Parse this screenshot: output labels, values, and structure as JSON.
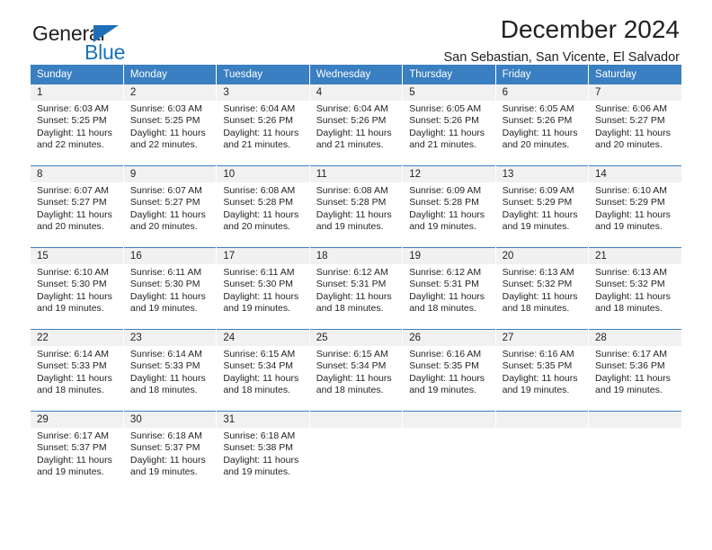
{
  "brand": {
    "name_part1": "General",
    "name_part2": "Blue",
    "accent_color": "#1872bb"
  },
  "header": {
    "title": "December 2024",
    "subtitle": "San Sebastian, San Vicente, El Salvador"
  },
  "calendar": {
    "header_bg": "#3a7fc1",
    "daynum_bg": "#f1f1f1",
    "weekday_headers": [
      "Sunday",
      "Monday",
      "Tuesday",
      "Wednesday",
      "Thursday",
      "Friday",
      "Saturday"
    ],
    "weeks": [
      [
        {
          "day": "1",
          "sunrise": "Sunrise: 6:03 AM",
          "sunset": "Sunset: 5:25 PM",
          "daylight1": "Daylight: 11 hours",
          "daylight2": "and 22 minutes."
        },
        {
          "day": "2",
          "sunrise": "Sunrise: 6:03 AM",
          "sunset": "Sunset: 5:25 PM",
          "daylight1": "Daylight: 11 hours",
          "daylight2": "and 22 minutes."
        },
        {
          "day": "3",
          "sunrise": "Sunrise: 6:04 AM",
          "sunset": "Sunset: 5:26 PM",
          "daylight1": "Daylight: 11 hours",
          "daylight2": "and 21 minutes."
        },
        {
          "day": "4",
          "sunrise": "Sunrise: 6:04 AM",
          "sunset": "Sunset: 5:26 PM",
          "daylight1": "Daylight: 11 hours",
          "daylight2": "and 21 minutes."
        },
        {
          "day": "5",
          "sunrise": "Sunrise: 6:05 AM",
          "sunset": "Sunset: 5:26 PM",
          "daylight1": "Daylight: 11 hours",
          "daylight2": "and 21 minutes."
        },
        {
          "day": "6",
          "sunrise": "Sunrise: 6:05 AM",
          "sunset": "Sunset: 5:26 PM",
          "daylight1": "Daylight: 11 hours",
          "daylight2": "and 20 minutes."
        },
        {
          "day": "7",
          "sunrise": "Sunrise: 6:06 AM",
          "sunset": "Sunset: 5:27 PM",
          "daylight1": "Daylight: 11 hours",
          "daylight2": "and 20 minutes."
        }
      ],
      [
        {
          "day": "8",
          "sunrise": "Sunrise: 6:07 AM",
          "sunset": "Sunset: 5:27 PM",
          "daylight1": "Daylight: 11 hours",
          "daylight2": "and 20 minutes."
        },
        {
          "day": "9",
          "sunrise": "Sunrise: 6:07 AM",
          "sunset": "Sunset: 5:27 PM",
          "daylight1": "Daylight: 11 hours",
          "daylight2": "and 20 minutes."
        },
        {
          "day": "10",
          "sunrise": "Sunrise: 6:08 AM",
          "sunset": "Sunset: 5:28 PM",
          "daylight1": "Daylight: 11 hours",
          "daylight2": "and 20 minutes."
        },
        {
          "day": "11",
          "sunrise": "Sunrise: 6:08 AM",
          "sunset": "Sunset: 5:28 PM",
          "daylight1": "Daylight: 11 hours",
          "daylight2": "and 19 minutes."
        },
        {
          "day": "12",
          "sunrise": "Sunrise: 6:09 AM",
          "sunset": "Sunset: 5:28 PM",
          "daylight1": "Daylight: 11 hours",
          "daylight2": "and 19 minutes."
        },
        {
          "day": "13",
          "sunrise": "Sunrise: 6:09 AM",
          "sunset": "Sunset: 5:29 PM",
          "daylight1": "Daylight: 11 hours",
          "daylight2": "and 19 minutes."
        },
        {
          "day": "14",
          "sunrise": "Sunrise: 6:10 AM",
          "sunset": "Sunset: 5:29 PM",
          "daylight1": "Daylight: 11 hours",
          "daylight2": "and 19 minutes."
        }
      ],
      [
        {
          "day": "15",
          "sunrise": "Sunrise: 6:10 AM",
          "sunset": "Sunset: 5:30 PM",
          "daylight1": "Daylight: 11 hours",
          "daylight2": "and 19 minutes."
        },
        {
          "day": "16",
          "sunrise": "Sunrise: 6:11 AM",
          "sunset": "Sunset: 5:30 PM",
          "daylight1": "Daylight: 11 hours",
          "daylight2": "and 19 minutes."
        },
        {
          "day": "17",
          "sunrise": "Sunrise: 6:11 AM",
          "sunset": "Sunset: 5:30 PM",
          "daylight1": "Daylight: 11 hours",
          "daylight2": "and 19 minutes."
        },
        {
          "day": "18",
          "sunrise": "Sunrise: 6:12 AM",
          "sunset": "Sunset: 5:31 PM",
          "daylight1": "Daylight: 11 hours",
          "daylight2": "and 18 minutes."
        },
        {
          "day": "19",
          "sunrise": "Sunrise: 6:12 AM",
          "sunset": "Sunset: 5:31 PM",
          "daylight1": "Daylight: 11 hours",
          "daylight2": "and 18 minutes."
        },
        {
          "day": "20",
          "sunrise": "Sunrise: 6:13 AM",
          "sunset": "Sunset: 5:32 PM",
          "daylight1": "Daylight: 11 hours",
          "daylight2": "and 18 minutes."
        },
        {
          "day": "21",
          "sunrise": "Sunrise: 6:13 AM",
          "sunset": "Sunset: 5:32 PM",
          "daylight1": "Daylight: 11 hours",
          "daylight2": "and 18 minutes."
        }
      ],
      [
        {
          "day": "22",
          "sunrise": "Sunrise: 6:14 AM",
          "sunset": "Sunset: 5:33 PM",
          "daylight1": "Daylight: 11 hours",
          "daylight2": "and 18 minutes."
        },
        {
          "day": "23",
          "sunrise": "Sunrise: 6:14 AM",
          "sunset": "Sunset: 5:33 PM",
          "daylight1": "Daylight: 11 hours",
          "daylight2": "and 18 minutes."
        },
        {
          "day": "24",
          "sunrise": "Sunrise: 6:15 AM",
          "sunset": "Sunset: 5:34 PM",
          "daylight1": "Daylight: 11 hours",
          "daylight2": "and 18 minutes."
        },
        {
          "day": "25",
          "sunrise": "Sunrise: 6:15 AM",
          "sunset": "Sunset: 5:34 PM",
          "daylight1": "Daylight: 11 hours",
          "daylight2": "and 18 minutes."
        },
        {
          "day": "26",
          "sunrise": "Sunrise: 6:16 AM",
          "sunset": "Sunset: 5:35 PM",
          "daylight1": "Daylight: 11 hours",
          "daylight2": "and 19 minutes."
        },
        {
          "day": "27",
          "sunrise": "Sunrise: 6:16 AM",
          "sunset": "Sunset: 5:35 PM",
          "daylight1": "Daylight: 11 hours",
          "daylight2": "and 19 minutes."
        },
        {
          "day": "28",
          "sunrise": "Sunrise: 6:17 AM",
          "sunset": "Sunset: 5:36 PM",
          "daylight1": "Daylight: 11 hours",
          "daylight2": "and 19 minutes."
        }
      ],
      [
        {
          "day": "29",
          "sunrise": "Sunrise: 6:17 AM",
          "sunset": "Sunset: 5:37 PM",
          "daylight1": "Daylight: 11 hours",
          "daylight2": "and 19 minutes."
        },
        {
          "day": "30",
          "sunrise": "Sunrise: 6:18 AM",
          "sunset": "Sunset: 5:37 PM",
          "daylight1": "Daylight: 11 hours",
          "daylight2": "and 19 minutes."
        },
        {
          "day": "31",
          "sunrise": "Sunrise: 6:18 AM",
          "sunset": "Sunset: 5:38 PM",
          "daylight1": "Daylight: 11 hours",
          "daylight2": "and 19 minutes."
        },
        {
          "day": "",
          "sunrise": "",
          "sunset": "",
          "daylight1": "",
          "daylight2": ""
        },
        {
          "day": "",
          "sunrise": "",
          "sunset": "",
          "daylight1": "",
          "daylight2": ""
        },
        {
          "day": "",
          "sunrise": "",
          "sunset": "",
          "daylight1": "",
          "daylight2": ""
        },
        {
          "day": "",
          "sunrise": "",
          "sunset": "",
          "daylight1": "",
          "daylight2": ""
        }
      ]
    ]
  }
}
